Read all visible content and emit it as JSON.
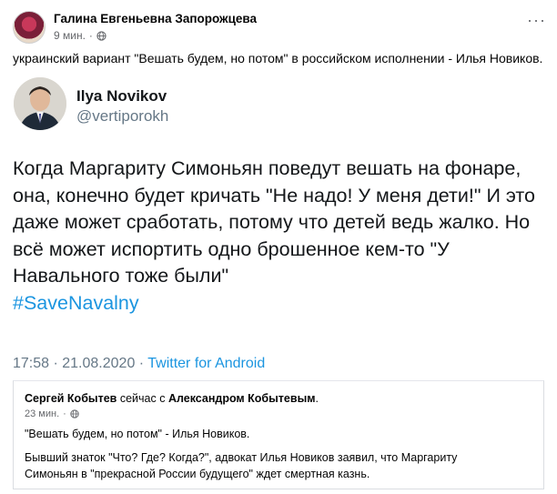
{
  "post": {
    "author": "Галина Евгеньевна Запорожцева",
    "time": "9 мин.",
    "privacy_icon": "globe-icon",
    "more_icon": "more-options-icon",
    "text": "украинский вариант \"Вешать будем, но потом\" в российском исполнении - Илья Новиков."
  },
  "tweet": {
    "name": "Ilya Novikov",
    "handle": "@vertiporokh",
    "lines": [
      "Когда Маргариту Симоньян поведут вешать на фонаре,",
      "она, конечно будет кричать \"Не надо! У меня дети!\" И это",
      "даже может сработать, потому что детей ведь жалко. Но",
      "всё может испортить одно брошенное кем-то \"У",
      "Навального тоже были\""
    ],
    "hashtag": "#SaveNavalny",
    "datetime": "17:58 · 21.08.2020 · ",
    "source": "Twitter for Android",
    "link_color": "#1b95e0"
  },
  "shared_post": {
    "author": "Сергей Кобытев",
    "with_text": " сейчас с ",
    "tagged": "Александром Кобытевым",
    "period": ".",
    "time": "23 мин.",
    "quote": "\"Вешать будем, но потом\" - Илья Новиков.",
    "body_lines": [
      "Бывший знаток \"Что? Где? Когда?\", адвокат Илья Новиков заявил, что Маргариту",
      "Симоньян в \"прекрасной России будущего\" ждет смертная казнь."
    ]
  }
}
